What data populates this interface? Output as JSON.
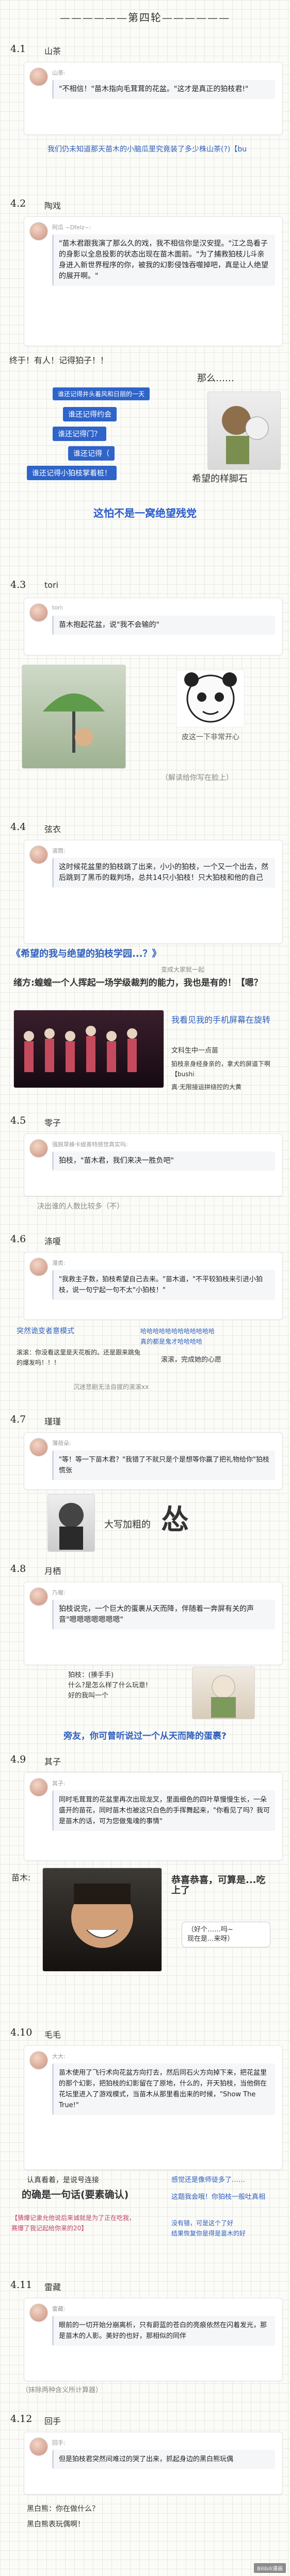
{
  "round_title": "——————第四轮——————",
  "sections": [
    {
      "num": "4.1",
      "name": "山茶",
      "user": "山茶:",
      "quote": "\"不相信！\"苗木指向毛茸茸的花盆。\"这才是真正的狛枝君!\"",
      "comment": "我们仍未知道那天苗木的小脑瓜里究竟装了多少株山茶(?)【bu"
    },
    {
      "num": "4.2",
      "name": "陶戏",
      "user": "阿瓜 ~Dfelz~:",
      "quote": "\"苗木君跟我演了那么久的戏，我不相信你是汉安提。\"江之岛看子的身影以全息投影的状态出现在苗木面前。\"为了捕救狛枝儿斗亲身进入新世界程序的你，被我的幻影侵蚀吞噬掉吧，真是让人绝望的展开啊。\"",
      "side_a": "终于！有人！记得狛子！！",
      "side_b": "那么……",
      "lines": [
        "谁还记得井头着风和日丽的一天",
        "谁还记得约会",
        "谁还记得门？",
        "谁还记得（",
        "谁还记得小狛枝掌着桩！"
      ],
      "side_c": "希望的样脚石",
      "side_d": "这怕不是一窝绝望残党"
    },
    {
      "num": "4.3",
      "name": "tori",
      "user": "tori:",
      "quote": "苗木抱起花盆，说\"我不会输的\"",
      "img_label": "皮这一下非常开心",
      "caption": "（解读给你写在脸上）"
    },
    {
      "num": "4.4",
      "name": "弦衣",
      "user": "滚筒:",
      "quote": "这时候花盆里的狛枝跳了出来，小小的狛枝，一个又一个出去，然后跳到了黑币的栽判场，总共14只小狛枝！只大狛枝和他的自己",
      "hl": "《希望的我与绝望的狛枝学园...？》",
      "side": "变成大家就一起",
      "line1": "绪方:蝗蝗一个人挥起一场学级裁判的能力，我也是有的！【嗯？",
      "line2": "我看见我的手机屏幕在旋转",
      "line3": "文科生中一点苗",
      "line4": "狛枝亲身经身亲的，拿犬的屏道下啊【bushi",
      "line5": "真·无限接运拼绕控的大黄"
    },
    {
      "num": "4.5",
      "name": "零子",
      "user": "强脱草蜂卡缇善特感觉真实吗:",
      "quote": "狛枝，\"苗木君，我们来决一胜负吧\"",
      "comment": "决出谁的人数比较多（不）"
    },
    {
      "num": "4.6",
      "name": "涤嗄",
      "user": "漫类:",
      "quote": "\"我救主子数，狛枝希望自己去来。\"苗木道，\"不平较狛枝来引进小狛枝，说一句宁起一句不太\"小狛枝！\"",
      "c1": "突然诡变者意模式",
      "c2": "哈哈哈哈哈哈哈哈哈哈哈哈\n真的都是鬼才哈哈哈哈",
      "c3": "滚滚：你没看这里是天花板的。还是跟来跳兔的爆发吗！！！",
      "c4": "滚滚，完成她的心愿",
      "c5": "沉迷悲剧无法自拔的滚滚xx"
    },
    {
      "num": "4.7",
      "name": "瑾瑾",
      "user": "薄荷朵:",
      "quote": "\"等！等一下苗木君？\"我错了不就只是个是想等你赢了把礼物给你\"狛枝慌张",
      "comment": "大写加粗的",
      "big": "怂"
    },
    {
      "num": "4.8",
      "name": "月栖",
      "user": "乃喔:",
      "quote": "狛枝说完，一个巨大的蛋裹从天而降，伴随着一奔屏有关的声音\"嗯嗯嗯嗯嗯嗯嗯\"",
      "c1": "狛枝：(揍手手)\n什么?是怎么样了什么玩意!\n好的我叫一个",
      "hl": "旁友，你可曾听说过一个从天而降的蛋裹?"
    },
    {
      "num": "4.9",
      "name": "其子",
      "user": "其子:",
      "quote": "同时毛茸茸的花盆里再次出现龙叉，里面细色的四叶草慢慢生长，一朵盛开的苗花，同时苗木也被这只白色的手挥舞起来，\"你看见了吗？我可是苗木的话，可为您做鬼魂的事情\"",
      "label": "苗木:",
      "b1": "恭喜恭喜，可算是...吃上了",
      "b2": "（好个……吗~\n现在是...来呀）",
      "hl": ""
    },
    {
      "num": "4.10",
      "name": "毛毛",
      "user": "大大:",
      "quote": "苗木使用了飞行术向花盆方向打去，然后同石火方向掉下来，把花盆里的那个幻影，把狛枝的幻影留在了原地，什么的，开天狛枝，当他倒在花坛里进入了游戏模式，当苗木从那里看出来的时候，\"Show The True!\"",
      "c1": "认真看着，是说号连接",
      "c2": "感觉还是像师徒多了……",
      "c3": "这题我会哦！你狛枝一般吐真相",
      "hl": "的确是一句话(要素确认)",
      "note": "【猜爆记隶允他说后来诚就是为了正在吃我，\n赛爆了我记起给你来的20】",
      "c4": "没有错，可是这个了好\n结果恢复你是得是苗木的好"
    },
    {
      "num": "4.11",
      "name": "雷藏",
      "user": "雷藏:",
      "quote": "眼前的一切开始分崩离析，只有蔚蓝的苍白的亮痕依然在闪着发光，那是苗木的人影。美好的也好，那相似的同伴",
      "caption": "（抹除两种含义所计算器）"
    },
    {
      "num": "4.12",
      "name": "回手",
      "user": "回手:",
      "quote": "但是狛枝君突然间难过的哭了出来，抓起身边的黑白熊玩偶",
      "c1": "黑白熊：你在做什么？",
      "c2": "黑白熊表玩偶啊！"
    }
  ],
  "watermark": "Bilibili漫画"
}
